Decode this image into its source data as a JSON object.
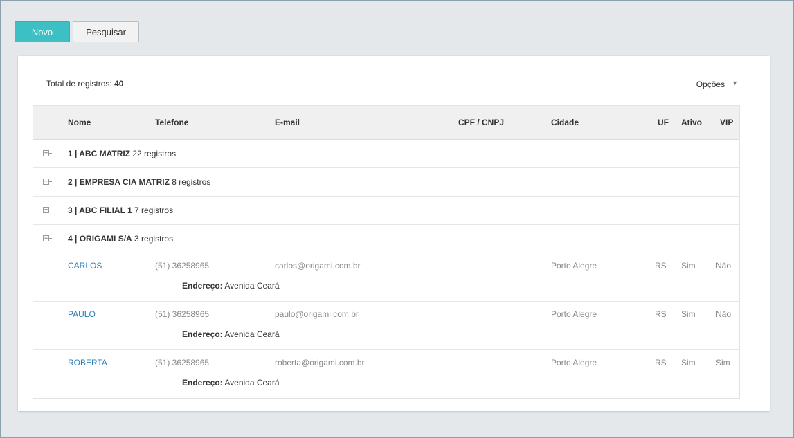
{
  "toolbar": {
    "new_label": "Novo",
    "search_label": "Pesquisar"
  },
  "summary": {
    "total_label": "Total de registros:",
    "total_value": "40",
    "options_label": "Opções"
  },
  "columns": [
    "Nome",
    "Telefone",
    "E-mail",
    "CPF / CNPJ",
    "Cidade",
    "UF",
    "Ativo",
    "VIP"
  ],
  "groups": [
    {
      "title": "1 | ABC MATRIZ",
      "count": "22 registros",
      "expanded": false
    },
    {
      "title": "2 | EMPRESA CIA MATRIZ",
      "count": "8 registros",
      "expanded": false
    },
    {
      "title": "3 | ABC FILIAL 1",
      "count": "7 registros",
      "expanded": false
    },
    {
      "title": "4 | ORIGAMI S/A",
      "count": "3 registros",
      "expanded": true
    }
  ],
  "address_label": "Endereço:",
  "rows": [
    {
      "name": "CARLOS",
      "phone": "(51) 36258965",
      "email": "carlos@origami.com.br",
      "city": "Porto Alegre",
      "uf": "RS",
      "active": "Sim",
      "vip": "Não",
      "address": "Avenida Ceará"
    },
    {
      "name": "PAULO",
      "phone": "(51) 36258965",
      "email": "paulo@origami.com.br",
      "city": "Porto Alegre",
      "uf": "RS",
      "active": "Sim",
      "vip": "Não",
      "address": "Avenida Ceará"
    },
    {
      "name": "ROBERTA",
      "phone": "(51) 36258965",
      "email": "roberta@origami.com.br",
      "city": "Porto Alegre",
      "uf": "RS",
      "active": "Sim",
      "vip": "Sim",
      "address": "Avenida Ceará"
    }
  ],
  "icons": {
    "collapsed": "plus-box-icon",
    "expanded": "minus-box-icon",
    "options_caret": "caret-down-icon"
  }
}
